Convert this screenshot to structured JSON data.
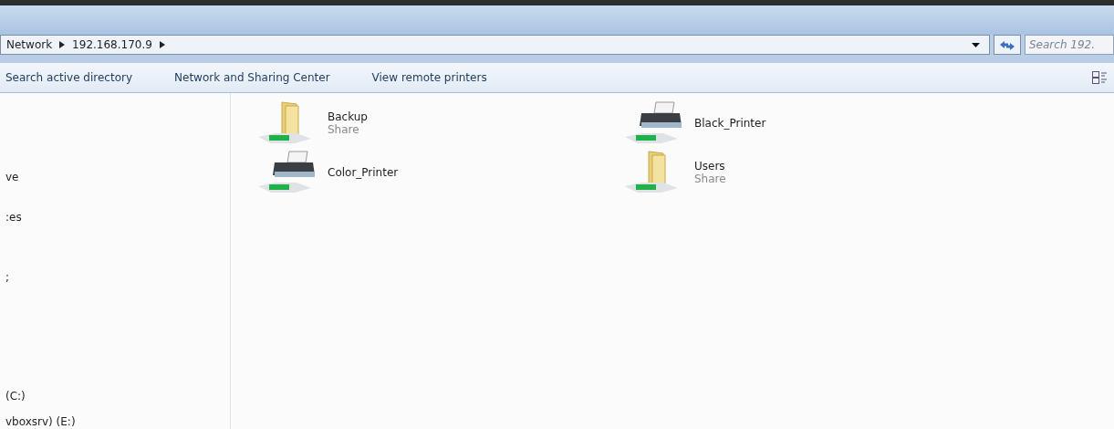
{
  "address_bar": {
    "crumbs": [
      "Network",
      "192.168.170.9"
    ]
  },
  "search": {
    "placeholder": "Search 192."
  },
  "toolbar": {
    "buttons": [
      "Search active directory",
      "Network and Sharing Center",
      "View remote printers"
    ]
  },
  "navigation_pane": {
    "items": [
      "ve",
      ":es",
      ";",
      "(C:)",
      "vboxsrv) (E:)"
    ]
  },
  "items": [
    {
      "kind": "folder",
      "name": "Backup",
      "subtitle": "Share"
    },
    {
      "kind": "printer",
      "name": "Black_Printer"
    },
    {
      "kind": "printer",
      "name": "Color_Printer"
    },
    {
      "kind": "folder",
      "name": "Users",
      "subtitle": "Share"
    }
  ]
}
